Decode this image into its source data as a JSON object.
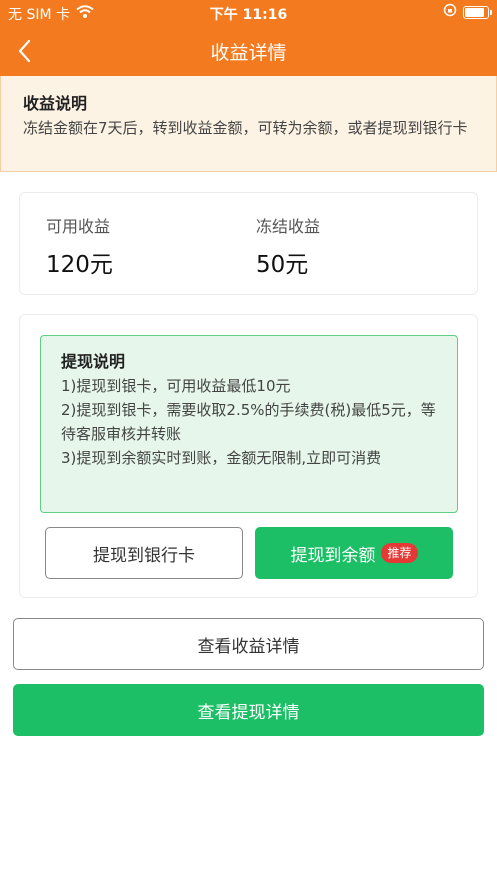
{
  "status_bar": {
    "carrier": "无 SIM 卡",
    "time": "下午 11:16"
  },
  "nav": {
    "title": "收益详情",
    "back_icon": "chevron-left-icon"
  },
  "notice": {
    "title": "收益说明",
    "text": "冻结金额在7天后，转到收益金额，可转为余额，或者提现到银行卡"
  },
  "income": {
    "available_label": "可用收益",
    "available_value": "120元",
    "frozen_label": "冻结收益",
    "frozen_value": "50元"
  },
  "withdraw": {
    "tip_title": "提现说明",
    "tip_lines": [
      "1)提现到银卡，可用收益最低10元",
      "2)提现到银卡，需要收取2.5%的手续费(税)最低5元，等待客服审核并转账",
      "3)提现到余额实时到账，金额无限制,立即可消费"
    ],
    "bank_button": "提现到银行卡",
    "balance_button": "提现到余额",
    "recommend_badge": "推荐"
  },
  "actions": {
    "view_income_details": "查看收益详情",
    "view_withdraw_details": "查看提现详情"
  },
  "colors": {
    "header": "#f47a1f",
    "green": "#1dbf66",
    "badge": "#e53935"
  }
}
